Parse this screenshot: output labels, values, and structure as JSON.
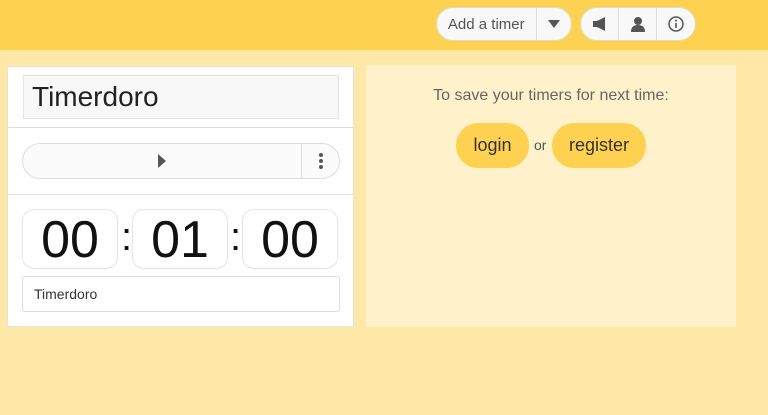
{
  "header": {
    "add_timer_label": "Add a timer",
    "icons": [
      "chevron-down-icon",
      "megaphone-icon",
      "user-icon",
      "info-icon"
    ]
  },
  "timer": {
    "name": "Timerdoro",
    "hours": "00",
    "minutes": "01",
    "seconds": "00",
    "separator": ":",
    "label": "Timerdoro"
  },
  "save_panel": {
    "message": "To save your timers for next time:",
    "login_label": "login",
    "or_text": "or",
    "register_label": "register"
  },
  "colors": {
    "topbar": "#fed250",
    "background": "#fee8a8",
    "panel": "#fff2cb",
    "accent": "#fed250"
  }
}
